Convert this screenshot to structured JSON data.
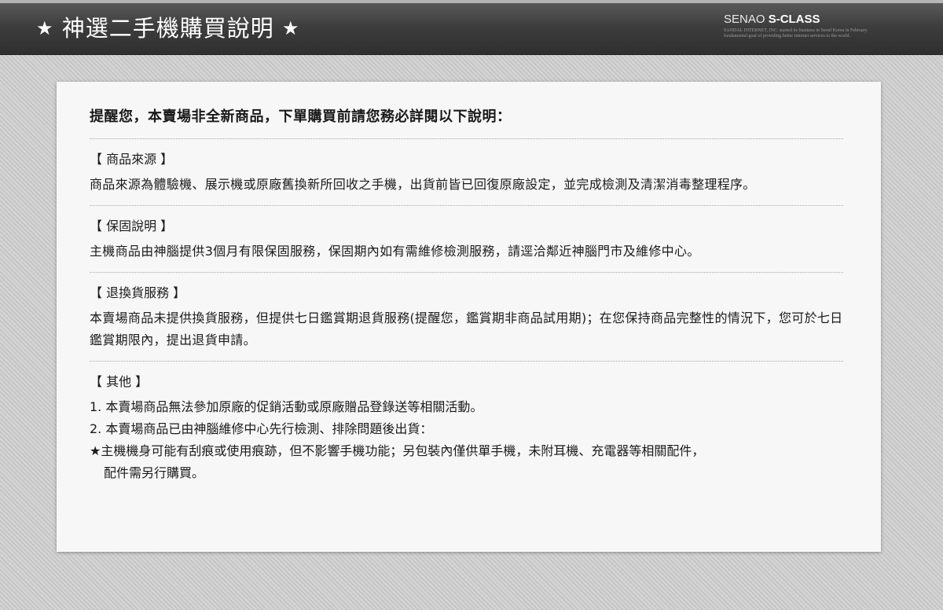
{
  "header": {
    "title_text": "神選二手機購買說明",
    "star_glyph": "★",
    "brand_prefix": "SENAO ",
    "brand_bold": "S-CLASS",
    "tagline_line1": "SANDAL INTERNET, INC. started its business in Seoul Korea in February",
    "tagline_line2": "fundamental goal of providing better internet services to the world."
  },
  "notice": {
    "intro": "提醒您，本賣場非全新商品，下單購買前請您務必詳閱以下說明：",
    "sections": [
      {
        "title": "【 商品來源 】",
        "body": "商品來源為體驗機、展示機或原廠舊換新所回收之手機，出貨前皆已回復原廠設定，並完成檢測及清潔消毒整理程序。"
      },
      {
        "title": "【 保固說明 】",
        "body": "主機商品由神腦提供3個月有限保固服務，保固期內如有需維修檢測服務，請逕洽鄰近神腦門市及維修中心。"
      },
      {
        "title": "【 退換貨服務 】",
        "body": "本賣場商品未提供換貨服務，但提供七日鑑賞期退貨服務(提醒您，鑑賞期非商品試用期)；在您保持商品完整性的情況下，您可於七日鑑賞期限內，提出退貨申請。"
      },
      {
        "title": "【 其他 】",
        "items": [
          "1. 本賣場商品無法參加原廠的促銷活動或原廠贈品登錄送等相關活動。",
          "2. 本賣場商品已由神腦維修中心先行檢測、排除問題後出貨：",
          "★主機機身可能有刮痕或使用痕跡，但不影響手機功能；另包裝內僅供單手機，未附耳機、充電器等相關配件，",
          "配件需另行購買。"
        ]
      }
    ]
  }
}
